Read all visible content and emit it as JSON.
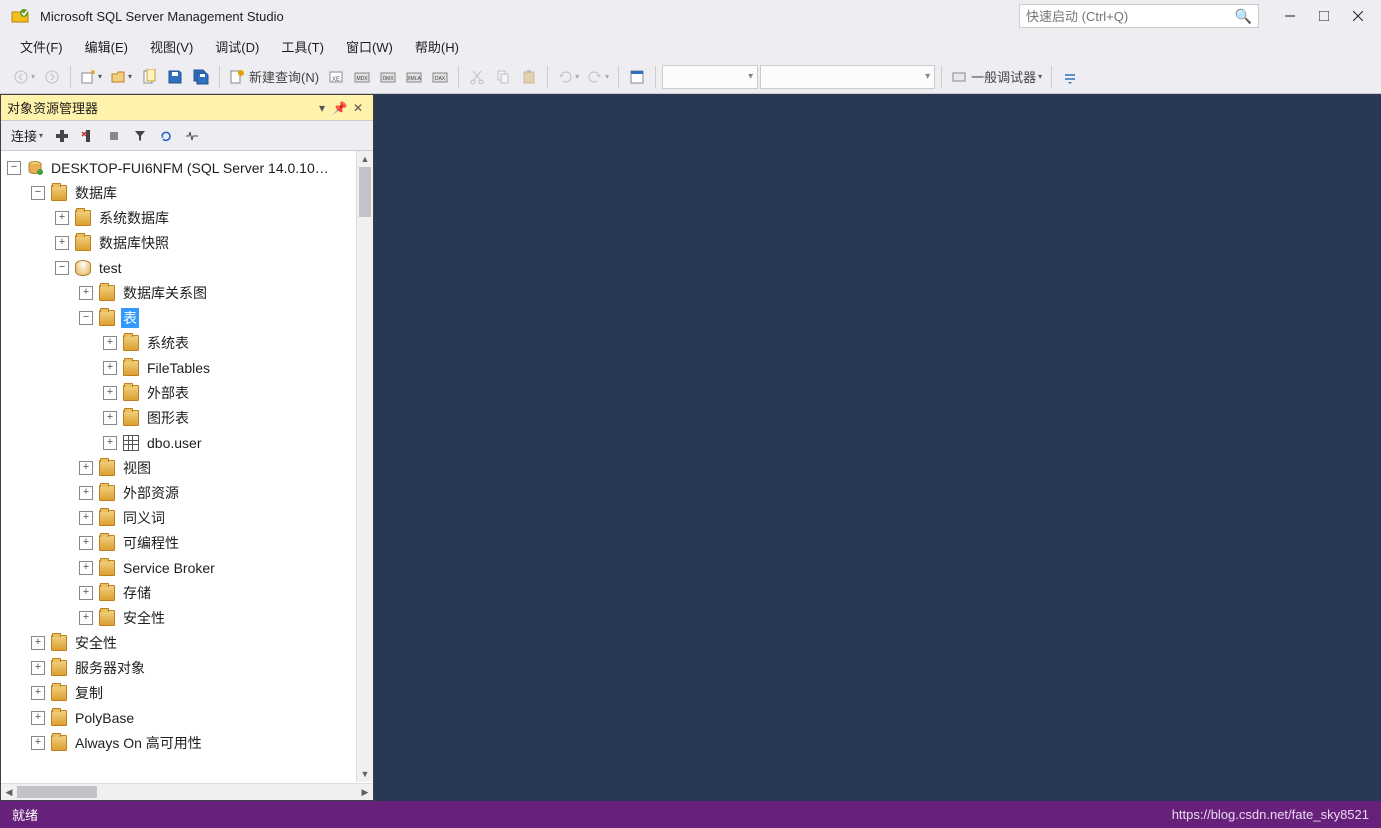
{
  "app": {
    "title": "Microsoft SQL Server Management Studio",
    "quick_launch_placeholder": "快速启动 (Ctrl+Q)"
  },
  "menu": {
    "file": "文件(F)",
    "edit": "编辑(E)",
    "view": "视图(V)",
    "debug": "调试(D)",
    "tools": "工具(T)",
    "window": "窗口(W)",
    "help": "帮助(H)"
  },
  "toolbar": {
    "new_query": "新建查询(N)",
    "debugger": "一般调试器"
  },
  "panel": {
    "title": "对象资源管理器",
    "connect": "连接"
  },
  "tree": {
    "server": "DESKTOP-FUI6NFM (SQL Server 14.0.10…",
    "databases": "数据库",
    "system_db": "系统数据库",
    "db_snapshot": "数据库快照",
    "test_db": "test",
    "db_diagrams": "数据库关系图",
    "tables": "表",
    "system_tables": "系统表",
    "filetables": "FileTables",
    "external_tables": "外部表",
    "graph_tables": "图形表",
    "dbo_user": "dbo.user",
    "views": "视图",
    "external_resources": "外部资源",
    "synonyms": "同义词",
    "programmability": "可编程性",
    "service_broker": "Service Broker",
    "storage": "存储",
    "security_db": "安全性",
    "security": "安全性",
    "server_objects": "服务器对象",
    "replication": "复制",
    "polybase": "PolyBase",
    "always_on": "Always On 高可用性"
  },
  "status": {
    "ready": "就绪"
  },
  "watermark": "https://blog.csdn.net/fate_sky8521"
}
